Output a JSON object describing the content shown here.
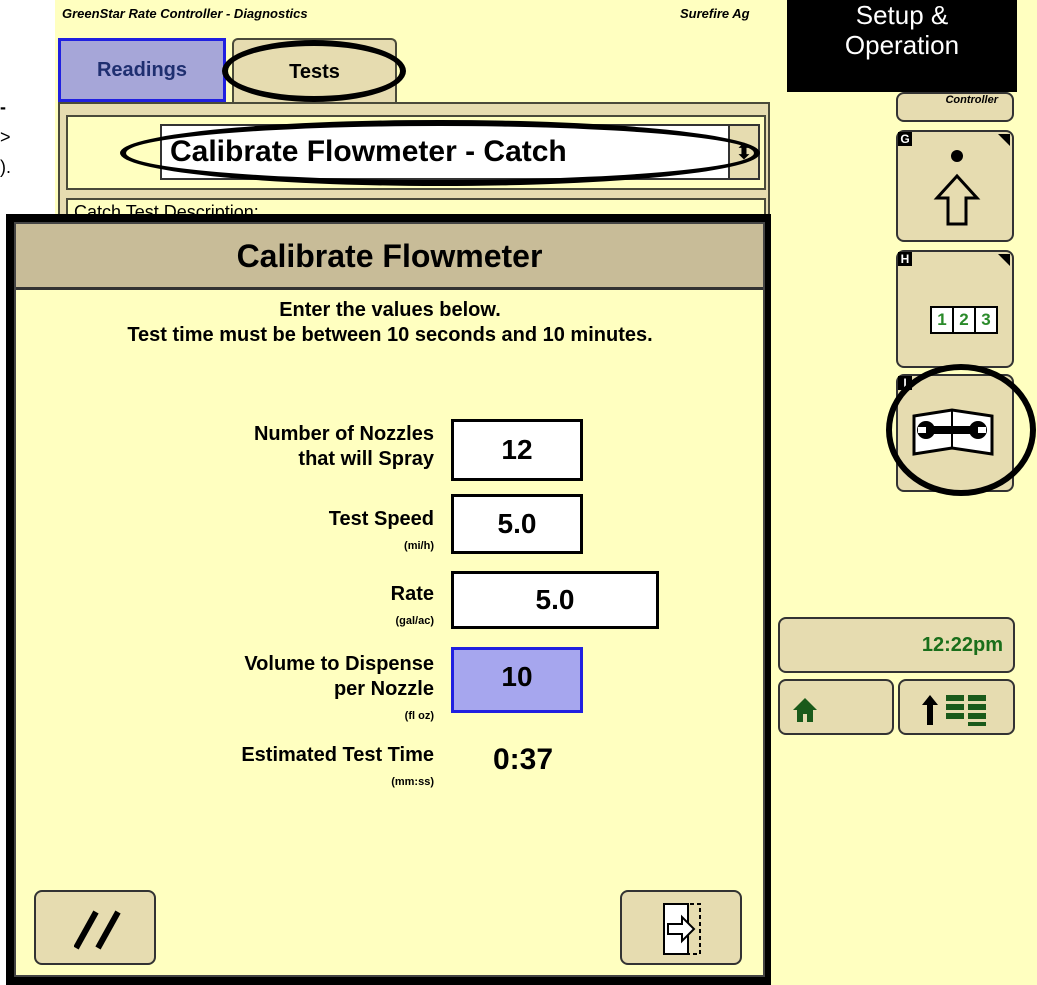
{
  "window": {
    "app_title": "GreenStar Rate Controller - Diagnostics",
    "brand": "Surefire Ag"
  },
  "overlay_label": {
    "line1": "Setup &",
    "line2": "Operation"
  },
  "tabs": [
    {
      "label": "Readings",
      "selected": false
    },
    {
      "label": "Tests",
      "selected": true
    }
  ],
  "test_select": {
    "value": "Calibrate Flowmeter - Catch",
    "arrow": "⬍"
  },
  "catch_description_label": "Catch Test Description:",
  "dialog": {
    "title": "Calibrate Flowmeter",
    "instructions": "Enter the values below.\nTest time must be between 10 seconds and 10 minutes.",
    "fields": [
      {
        "label_line1": "Number of Nozzles",
        "label_line2": "that will Spray",
        "unit": "",
        "value": "12"
      },
      {
        "label_line1": "Test Speed",
        "label_line2": "",
        "unit": "(mi/h)",
        "value": "5.0"
      },
      {
        "label_line1": "Rate",
        "label_line2": "",
        "unit": "(gal/ac)",
        "value": "5.0"
      },
      {
        "label_line1": "Volume to Dispense",
        "label_line2": "per Nozzle",
        "unit": "(fl oz)",
        "value": "10"
      }
    ],
    "estimated": {
      "label": "Estimated Test Time",
      "unit": "(mm:ss)",
      "value": "0:37"
    },
    "cancel_icon": "//",
    "enter_icon": "exit-arrow"
  },
  "side_buttons": [
    {
      "letter": "G",
      "icon": "up-arrow-icon"
    },
    {
      "letter": "H",
      "icon": "numeric-123-icon",
      "digits": [
        "1",
        "2",
        "3"
      ]
    },
    {
      "letter": "I",
      "icon": "wrench-book-icon"
    }
  ],
  "clock": "12:22pm",
  "top_partial_label": "Controller",
  "colors": {
    "background": "#ffffc0",
    "button": "#e6dcb0",
    "selected_field": "#a6a6ee",
    "clock_text": "#1a6e1a"
  }
}
